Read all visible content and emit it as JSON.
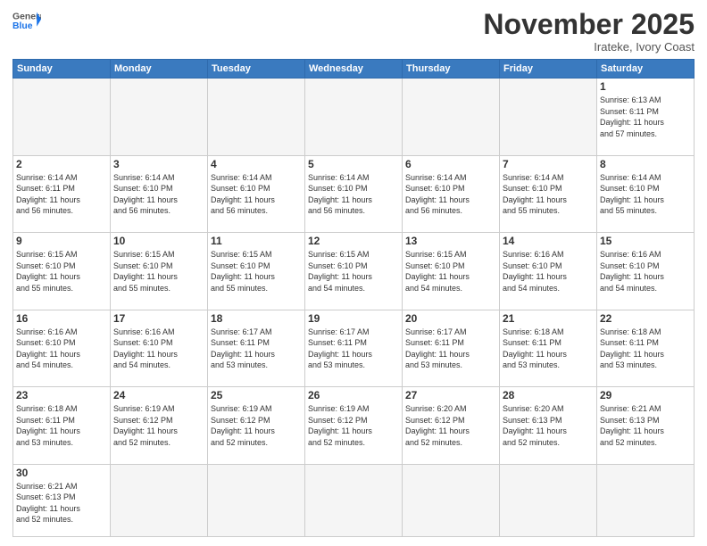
{
  "header": {
    "logo_general": "General",
    "logo_blue": "Blue",
    "month": "November 2025",
    "location": "Irateke, Ivory Coast"
  },
  "weekdays": [
    "Sunday",
    "Monday",
    "Tuesday",
    "Wednesday",
    "Thursday",
    "Friday",
    "Saturday"
  ],
  "weeks": [
    [
      {
        "day": "",
        "info": ""
      },
      {
        "day": "",
        "info": ""
      },
      {
        "day": "",
        "info": ""
      },
      {
        "day": "",
        "info": ""
      },
      {
        "day": "",
        "info": ""
      },
      {
        "day": "",
        "info": ""
      },
      {
        "day": "1",
        "info": "Sunrise: 6:13 AM\nSunset: 6:11 PM\nDaylight: 11 hours\nand 57 minutes."
      }
    ],
    [
      {
        "day": "2",
        "info": "Sunrise: 6:14 AM\nSunset: 6:11 PM\nDaylight: 11 hours\nand 56 minutes."
      },
      {
        "day": "3",
        "info": "Sunrise: 6:14 AM\nSunset: 6:10 PM\nDaylight: 11 hours\nand 56 minutes."
      },
      {
        "day": "4",
        "info": "Sunrise: 6:14 AM\nSunset: 6:10 PM\nDaylight: 11 hours\nand 56 minutes."
      },
      {
        "day": "5",
        "info": "Sunrise: 6:14 AM\nSunset: 6:10 PM\nDaylight: 11 hours\nand 56 minutes."
      },
      {
        "day": "6",
        "info": "Sunrise: 6:14 AM\nSunset: 6:10 PM\nDaylight: 11 hours\nand 56 minutes."
      },
      {
        "day": "7",
        "info": "Sunrise: 6:14 AM\nSunset: 6:10 PM\nDaylight: 11 hours\nand 55 minutes."
      },
      {
        "day": "8",
        "info": "Sunrise: 6:14 AM\nSunset: 6:10 PM\nDaylight: 11 hours\nand 55 minutes."
      }
    ],
    [
      {
        "day": "9",
        "info": "Sunrise: 6:15 AM\nSunset: 6:10 PM\nDaylight: 11 hours\nand 55 minutes."
      },
      {
        "day": "10",
        "info": "Sunrise: 6:15 AM\nSunset: 6:10 PM\nDaylight: 11 hours\nand 55 minutes."
      },
      {
        "day": "11",
        "info": "Sunrise: 6:15 AM\nSunset: 6:10 PM\nDaylight: 11 hours\nand 55 minutes."
      },
      {
        "day": "12",
        "info": "Sunrise: 6:15 AM\nSunset: 6:10 PM\nDaylight: 11 hours\nand 54 minutes."
      },
      {
        "day": "13",
        "info": "Sunrise: 6:15 AM\nSunset: 6:10 PM\nDaylight: 11 hours\nand 54 minutes."
      },
      {
        "day": "14",
        "info": "Sunrise: 6:16 AM\nSunset: 6:10 PM\nDaylight: 11 hours\nand 54 minutes."
      },
      {
        "day": "15",
        "info": "Sunrise: 6:16 AM\nSunset: 6:10 PM\nDaylight: 11 hours\nand 54 minutes."
      }
    ],
    [
      {
        "day": "16",
        "info": "Sunrise: 6:16 AM\nSunset: 6:10 PM\nDaylight: 11 hours\nand 54 minutes."
      },
      {
        "day": "17",
        "info": "Sunrise: 6:16 AM\nSunset: 6:10 PM\nDaylight: 11 hours\nand 54 minutes."
      },
      {
        "day": "18",
        "info": "Sunrise: 6:17 AM\nSunset: 6:11 PM\nDaylight: 11 hours\nand 53 minutes."
      },
      {
        "day": "19",
        "info": "Sunrise: 6:17 AM\nSunset: 6:11 PM\nDaylight: 11 hours\nand 53 minutes."
      },
      {
        "day": "20",
        "info": "Sunrise: 6:17 AM\nSunset: 6:11 PM\nDaylight: 11 hours\nand 53 minutes."
      },
      {
        "day": "21",
        "info": "Sunrise: 6:18 AM\nSunset: 6:11 PM\nDaylight: 11 hours\nand 53 minutes."
      },
      {
        "day": "22",
        "info": "Sunrise: 6:18 AM\nSunset: 6:11 PM\nDaylight: 11 hours\nand 53 minutes."
      }
    ],
    [
      {
        "day": "23",
        "info": "Sunrise: 6:18 AM\nSunset: 6:11 PM\nDaylight: 11 hours\nand 53 minutes."
      },
      {
        "day": "24",
        "info": "Sunrise: 6:19 AM\nSunset: 6:12 PM\nDaylight: 11 hours\nand 52 minutes."
      },
      {
        "day": "25",
        "info": "Sunrise: 6:19 AM\nSunset: 6:12 PM\nDaylight: 11 hours\nand 52 minutes."
      },
      {
        "day": "26",
        "info": "Sunrise: 6:19 AM\nSunset: 6:12 PM\nDaylight: 11 hours\nand 52 minutes."
      },
      {
        "day": "27",
        "info": "Sunrise: 6:20 AM\nSunset: 6:12 PM\nDaylight: 11 hours\nand 52 minutes."
      },
      {
        "day": "28",
        "info": "Sunrise: 6:20 AM\nSunset: 6:13 PM\nDaylight: 11 hours\nand 52 minutes."
      },
      {
        "day": "29",
        "info": "Sunrise: 6:21 AM\nSunset: 6:13 PM\nDaylight: 11 hours\nand 52 minutes."
      }
    ],
    [
      {
        "day": "30",
        "info": "Sunrise: 6:21 AM\nSunset: 6:13 PM\nDaylight: 11 hours\nand 52 minutes."
      },
      {
        "day": "",
        "info": ""
      },
      {
        "day": "",
        "info": ""
      },
      {
        "day": "",
        "info": ""
      },
      {
        "day": "",
        "info": ""
      },
      {
        "day": "",
        "info": ""
      },
      {
        "day": "",
        "info": ""
      }
    ]
  ]
}
